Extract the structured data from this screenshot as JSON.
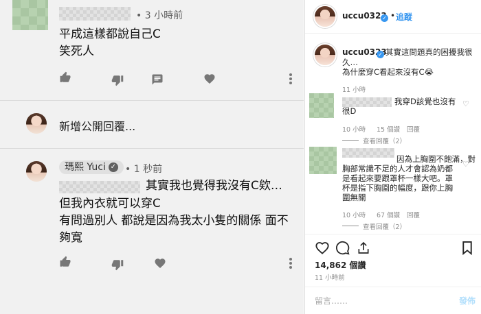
{
  "youtube": {
    "comment1": {
      "time": "3 小時前",
      "lines": [
        "平成這樣都說自己C",
        "笑死人"
      ]
    },
    "add_reply_placeholder": "新增公開回覆...",
    "reply": {
      "author": "瑪熙 Yuci",
      "time": "1 秒前",
      "line1_tail": "其實我也覺得我沒有C欸…",
      "lines": [
        "但我內衣就可以穿C",
        "有問過別人 都說是因為我太小隻的關係 面不",
        "夠寬"
      ]
    },
    "icons": {
      "like": "thumbs-up-icon",
      "dislike": "thumbs-down-icon",
      "reply": "reply-comment-icon",
      "heart": "heart-icon",
      "more": "more-vertical-icon"
    }
  },
  "instagram": {
    "username": "uccu0323",
    "follow_label": "追蹤",
    "caption_user": "uccu0323",
    "caption_lines": [
      "其實這問題真的困擾我很",
      "久…",
      "為什麼穿C看起來沒有C😭"
    ],
    "caption_time": "11 小時",
    "comment1": {
      "lines": [
        "我穿D該覺也沒有",
        "很D"
      ],
      "time": "10 小時",
      "likes": "15 個讚",
      "reply_label": "回覆",
      "view_replies": "查看回覆（2）"
    },
    "comment2": {
      "lines": [
        "因為上胸圍不飽滿，對",
        "胸部常識不足的人才會認為奶都",
        "是看起來要跟罩杯一樣大吧。罩",
        "杯是指下胸圍的幅度，跟你上胸",
        "圍無關"
      ],
      "time": "10 小時",
      "likes": "67 個讚",
      "reply_label": "回覆",
      "view_replies": "查看回覆（2）"
    },
    "likes_count": "14,862",
    "likes_label": "個讚",
    "post_time": "11 小時前",
    "comment_placeholder": "留言……",
    "post_button": "發佈",
    "colors": {
      "accent": "#3897f0",
      "post_disabled": "#b2dffc"
    }
  }
}
